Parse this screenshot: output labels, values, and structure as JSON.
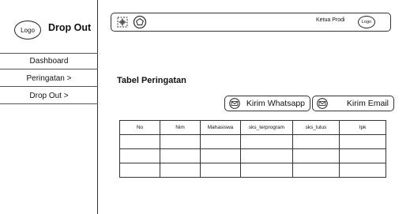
{
  "sidebar": {
    "logo_text": "Logo",
    "brand": "Drop Out",
    "items": [
      {
        "label": "Dashboard"
      },
      {
        "label": "Peringatan  >"
      },
      {
        "label": "Drop Out  >"
      }
    ]
  },
  "topbar": {
    "icons": [
      "crosshair-icon",
      "pentagon-icon"
    ],
    "role": "Ketua Prodi",
    "avatar_text": "Logo"
  },
  "main": {
    "title": "Tabel Peringatan",
    "buttons": {
      "whatsapp": "Kirim Whatsapp",
      "email": "Kirim Email"
    },
    "table": {
      "columns": [
        "No",
        "Nim",
        "Mahasiswa",
        "sks_terprogram",
        "sks_lulus",
        "Ipk"
      ],
      "rows": [
        [
          "",
          "",
          "",
          "",
          "",
          ""
        ],
        [
          "",
          "",
          "",
          "",
          "",
          ""
        ],
        [
          "",
          "",
          "",
          "",
          "",
          ""
        ]
      ]
    }
  }
}
